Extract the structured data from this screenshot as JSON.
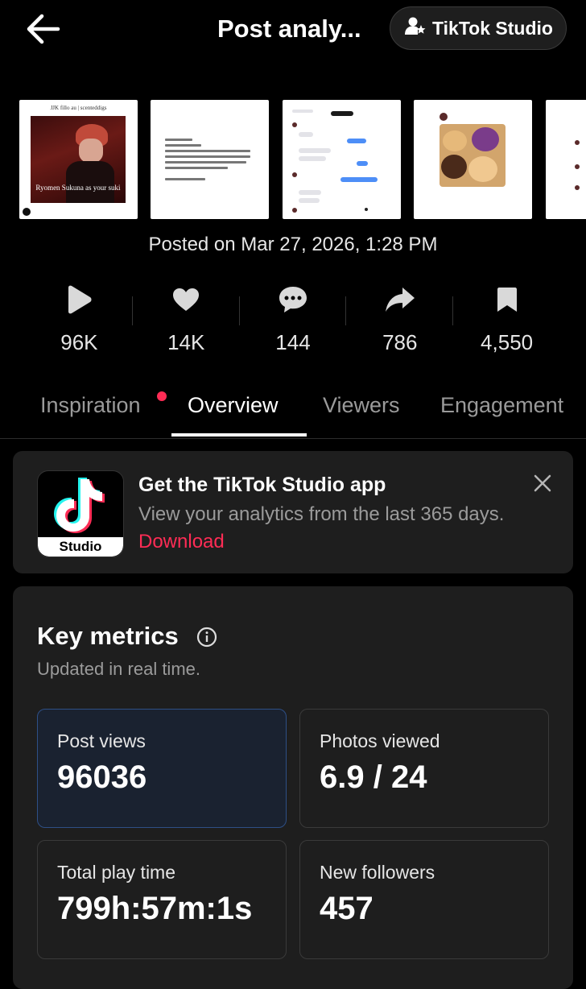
{
  "header": {
    "title": "Post analy...",
    "studio_button": "TikTok Studio"
  },
  "posted": "Posted on Mar 27, 2026, 1:28 PM",
  "thumbnails": {
    "first_caption": "JJK fillo au | scenteddigs",
    "first_label": "Ryomen Sukuna as your suki"
  },
  "stats": [
    {
      "icon": "play-icon",
      "value": "96K"
    },
    {
      "icon": "heart-icon",
      "value": "14K"
    },
    {
      "icon": "comment-icon",
      "value": "144"
    },
    {
      "icon": "share-icon",
      "value": "786"
    },
    {
      "icon": "bookmark-icon",
      "value": "4,550"
    }
  ],
  "tabs": [
    {
      "label": "Inspiration",
      "dot": true
    },
    {
      "label": "Overview",
      "active": true
    },
    {
      "label": "Viewers"
    },
    {
      "label": "Engagement"
    }
  ],
  "promo": {
    "app_label": "Studio",
    "title": "Get the TikTok Studio app",
    "description": "View your analytics from the last 365 days.",
    "link": "Download"
  },
  "metrics": {
    "title": "Key metrics",
    "subtitle": "Updated in real time.",
    "cards": [
      {
        "label": "Post views",
        "value": "96036"
      },
      {
        "label": "Photos viewed",
        "value": "6.9 / 24"
      },
      {
        "label": "Total play time",
        "value": "799h:57m:1s"
      },
      {
        "label": "New followers",
        "value": "457"
      }
    ]
  },
  "colors": {
    "accent": "#fe2c55",
    "background": "#000000",
    "card": "#1e1e1e"
  }
}
